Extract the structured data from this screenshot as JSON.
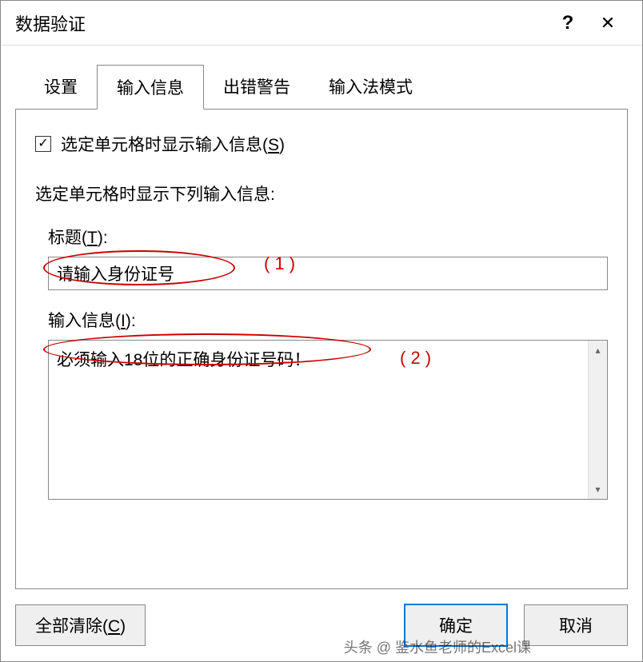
{
  "dialog": {
    "title": "数据验证",
    "help": "?",
    "close": "✕"
  },
  "tabs": {
    "settings": "设置",
    "input_message": "输入信息",
    "error_alert": "出错警告",
    "ime_mode": "输入法模式"
  },
  "panel": {
    "checkbox_checked": "✓",
    "checkbox_label_pre": "选定单元格时显示输入信息(",
    "checkbox_label_key": "S",
    "checkbox_label_post": ")",
    "section_text": "选定单元格时显示下列输入信息:",
    "title_label_pre": "标题(",
    "title_label_key": "T",
    "title_label_post": "):",
    "title_value": "请输入身份证号",
    "message_label_pre": "输入信息(",
    "message_label_key": "I",
    "message_label_post": "):",
    "message_value": "必须输入18位的正确身份证号码！"
  },
  "annotations": {
    "one": "( 1 )",
    "two": "( 2 )"
  },
  "buttons": {
    "clear_all_pre": "全部清除(",
    "clear_all_key": "C",
    "clear_all_post": ")",
    "ok": "确定",
    "cancel": "取消"
  },
  "watermark": "头条 @ 鉴水鱼老师的Excel课"
}
